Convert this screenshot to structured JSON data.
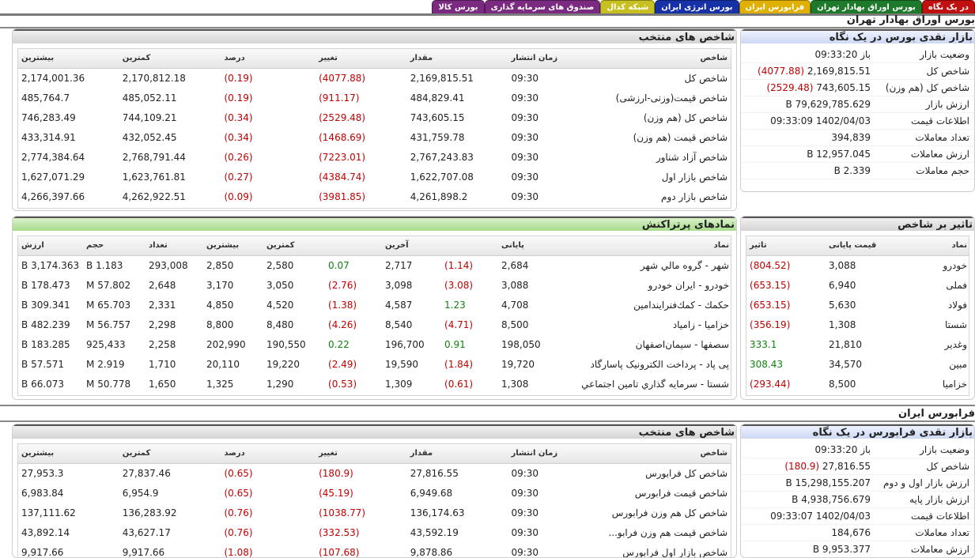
{
  "top_tabs": [
    {
      "label": "در یک نگاه",
      "color": "#c01010"
    },
    {
      "label": "بورس اوراق بهادار تهران",
      "color": "#1d7a2a"
    },
    {
      "label": "فرابورس ایران",
      "color": "#e0b000"
    },
    {
      "label": "بورس انرژی ایران",
      "color": "#1630a8"
    },
    {
      "label": "شبکه کدال",
      "color": "#c8c020"
    },
    {
      "label": "صندوق های سرمایه گذاری",
      "color": "#7a2a80"
    },
    {
      "label": "بورس کالا",
      "color": "#7a2a80"
    }
  ],
  "tse": {
    "section_title": "بورس اوراق بهادار تهران",
    "overview": {
      "title": "بازار نقدی بورس در یک نگاه",
      "rows": [
        {
          "key": "وضعیت بازار",
          "value": "باز 09:33:20",
          "extra": ""
        },
        {
          "key": "شاخص کل",
          "value": "2,169,815.51",
          "extra": "(4077.88)"
        },
        {
          "key": "شاخص کل (هم وزن)",
          "value": "743,605.15",
          "extra": "(2529.48)"
        },
        {
          "key": "ارزش بازار",
          "value": "79,629,785.629 B",
          "extra": ""
        },
        {
          "key": "اطلاعات قیمت",
          "value": "1402/04/03 09:33:09",
          "extra": ""
        },
        {
          "key": "تعداد معاملات",
          "value": "394,839",
          "extra": ""
        },
        {
          "key": "ارزش معاملات",
          "value": "12,957.045 B",
          "extra": ""
        },
        {
          "key": "حجم معاملات",
          "value": "2.339 B",
          "extra": ""
        }
      ]
    },
    "indices": {
      "title": "شاخص های منتخب",
      "headers": [
        "شاخص",
        "زمان انتشار",
        "مقدار",
        "تغییر",
        "درصد",
        "کمترین",
        "بیشترین"
      ],
      "rows": [
        [
          "شاخص کل",
          "09:30",
          "2,169,815.51",
          "(4077.88)",
          "(0.19)",
          "2,170,812.18",
          "2,174,001.36"
        ],
        [
          "شاخص قیمت(وزنی-ارزشی)",
          "09:30",
          "484,829.41",
          "(911.17)",
          "(0.19)",
          "485,052.11",
          "485,764.7"
        ],
        [
          "شاخص کل (هم وزن)",
          "09:30",
          "743,605.15",
          "(2529.48)",
          "(0.34)",
          "744,109.21",
          "746,283.49"
        ],
        [
          "شاخص قیمت (هم وزن)",
          "09:30",
          "431,759.78",
          "(1468.69)",
          "(0.34)",
          "432,052.45",
          "433,314.91"
        ],
        [
          "شاخص آزاد شناور",
          "09:30",
          "2,767,243.83",
          "(7223.01)",
          "(0.26)",
          "2,768,791.44",
          "2,774,384.64"
        ],
        [
          "شاخص بازار اول",
          "09:30",
          "1,622,707.08",
          "(4384.74)",
          "(0.27)",
          "1,623,761.81",
          "1,627,071.29"
        ],
        [
          "شاخص بازار دوم",
          "09:30",
          "4,261,898.2",
          "(3981.85)",
          "(0.09)",
          "4,262,922.51",
          "4,266,397.66"
        ]
      ]
    },
    "symbols": {
      "title": "نمادهای پرتراکنش",
      "headers": [
        "نماد",
        "پایانی",
        "",
        "آخرین",
        "",
        "کمترین",
        "بیشترین",
        "تعداد",
        "حجم",
        "ارزش"
      ],
      "rows": [
        [
          "شهر - گروه مالي شهر",
          "2,684",
          "(1.14)",
          "2,717",
          "0.07",
          "2,580",
          "2,850",
          "293,008",
          "1.183 B",
          "3,174.363 B"
        ],
        [
          "خودرو - ايران‌ خودرو",
          "3,088",
          "(3.08)",
          "3,098",
          "(2.76)",
          "3,050",
          "3,170",
          "2,648",
          "57.802 M",
          "178.473 B"
        ],
        [
          "حكمك - كمك‌فنرايندامين‌",
          "4,708",
          "1.23",
          "4,587",
          "(1.38)",
          "4,520",
          "4,850",
          "2,331",
          "65.703 M",
          "309.341 B"
        ],
        [
          "خزاميا - زامياد",
          "8,500",
          "(4.71)",
          "8,540",
          "(4.26)",
          "8,480",
          "8,800",
          "2,298",
          "56.757 M",
          "482.239 B"
        ],
        [
          "سصفها - سيمان‌اصفهان‌",
          "198,050",
          "0.91",
          "196,700",
          "0.22",
          "190,550",
          "202,990",
          "2,258",
          "925,433",
          "183.285 B"
        ],
        [
          "پی پاد - پرداخت الکترونيک پاسارگاد",
          "19,720",
          "(1.84)",
          "19,590",
          "(2.49)",
          "19,220",
          "20,110",
          "1,710",
          "2.919 M",
          "57.571 B"
        ],
        [
          "شستا - سرمايه گذاري تامين اجتماعي",
          "1,308",
          "(0.61)",
          "1,309",
          "(0.53)",
          "1,290",
          "1,325",
          "1,650",
          "50.778 M",
          "66.073 B"
        ]
      ]
    },
    "impact": {
      "title": "تاثیر بر شاخص",
      "headers": [
        "نماد",
        "قیمت پایانی",
        "تاثیر"
      ],
      "rows": [
        [
          "خودرو",
          "3,088",
          "(804.52)"
        ],
        [
          "فملی",
          "6,940",
          "(653.15)"
        ],
        [
          "فولاد",
          "5,630",
          "(653.15)"
        ],
        [
          "شستا",
          "1,308",
          "(356.19)"
        ],
        [
          "وغدیر",
          "21,810",
          "333.1"
        ],
        [
          "مبین",
          "34,570",
          "308.43"
        ],
        [
          "خزامیا",
          "8,500",
          "(293.44)"
        ]
      ]
    }
  },
  "ifb": {
    "section_title": "فرابورس ایران",
    "overview": {
      "title": "بازار نقدی فرابورس در یک نگاه",
      "rows": [
        {
          "key": "وضعیت بازار",
          "value": "باز 09:33:20",
          "extra": ""
        },
        {
          "key": "شاخص کل",
          "value": "27,816.55",
          "extra": "(180.9)"
        },
        {
          "key": "ارزش بازار اول و دوم",
          "value": "15,298,155.207 B",
          "extra": ""
        },
        {
          "key": "ارزش بازار پایه",
          "value": "4,938,756.679 B",
          "extra": ""
        },
        {
          "key": "اطلاعات قیمت",
          "value": "1402/04/03 09:33:07",
          "extra": ""
        },
        {
          "key": "تعداد معاملات",
          "value": "184,676",
          "extra": ""
        },
        {
          "key": "ارزش معاملات",
          "value": "9,953.377 B",
          "extra": ""
        }
      ]
    },
    "indices": {
      "title": "شاخص های منتخب",
      "headers": [
        "شاخص",
        "زمان انتشار",
        "مقدار",
        "تغییر",
        "درصد",
        "کمترین",
        "بیشترین"
      ],
      "rows": [
        [
          "شاخص کل فرابورس",
          "09:30",
          "27,816.55",
          "(180.9)",
          "(0.65)",
          "27,837.46",
          "27,953.3"
        ],
        [
          "شاخص قیمت فرابورس",
          "09:30",
          "6,949.68",
          "(45.19)",
          "(0.65)",
          "6,954.9",
          "6,983.84"
        ],
        [
          "شاخص کل هم وزن فرابورس",
          "09:30",
          "136,174.63",
          "(1038.77)",
          "(0.76)",
          "136,283.92",
          "137,111.62"
        ],
        [
          "شاخص قیمت هم وزن فرابو...",
          "09:30",
          "43,592.19",
          "(332.53)",
          "(0.76)",
          "43,627.17",
          "43,892.14"
        ],
        [
          "شاخص بازار اول فرابورس",
          "09:30",
          "9,878.86",
          "(107.68)",
          "(1.08)",
          "9,917.66",
          "9,917.66"
        ]
      ]
    }
  }
}
